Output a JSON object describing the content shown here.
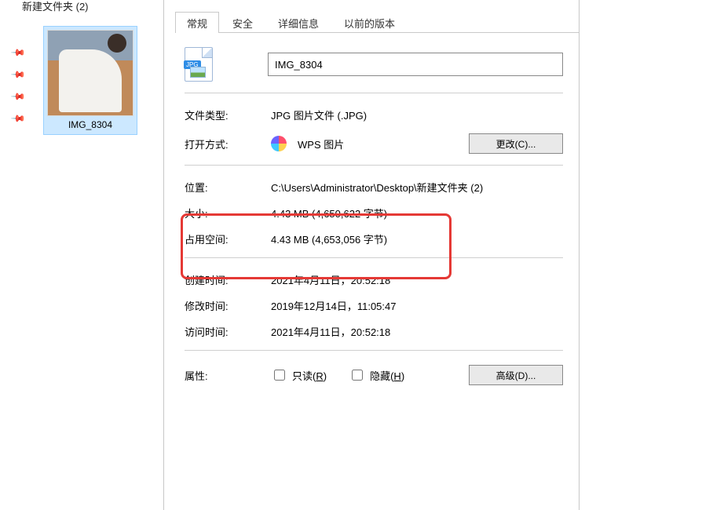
{
  "explorer": {
    "breadcrumb": "新建文件夹 (2)",
    "file_label": "IMG_8304"
  },
  "dialog": {
    "tabs": {
      "general": "常规",
      "security": "安全",
      "details": "详细信息",
      "prev": "以前的版本"
    },
    "filename": "IMG_8304",
    "labels": {
      "filetype": "文件类型:",
      "openwith": "打开方式:",
      "location": "位置:",
      "size": "大小:",
      "sizeondisk": "占用空间:",
      "created": "创建时间:",
      "modified": "修改时间:",
      "accessed": "访问时间:",
      "attributes": "属性:"
    },
    "values": {
      "filetype": "JPG 图片文件 (.JPG)",
      "openwith": "WPS 图片",
      "location": "C:\\Users\\Administrator\\Desktop\\新建文件夹 (2)",
      "size": "4.43 MB (4,650,622 字节)",
      "sizeondisk": "4.43 MB (4,653,056 字节)",
      "created": "2021年4月11日，20:52:18",
      "modified": "2019年12月14日，11:05:47",
      "accessed": "2021年4月11日，20:52:18"
    },
    "buttons": {
      "change": "更改(C)...",
      "advanced": "高级(D)..."
    },
    "checkboxes": {
      "readonly_pre": "只读(",
      "readonly_u": "R",
      "readonly_post": ")",
      "hidden_pre": "隐藏(",
      "hidden_u": "H",
      "hidden_post": ")"
    },
    "icon_badge": "JPG"
  }
}
